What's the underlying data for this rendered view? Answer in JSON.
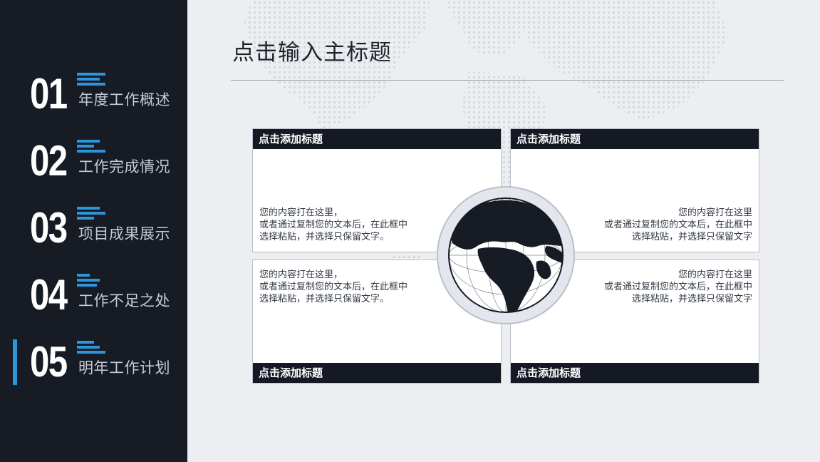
{
  "sidebar": {
    "items": [
      {
        "number": "01",
        "label": "年度工作概述"
      },
      {
        "number": "02",
        "label": "工作完成情况"
      },
      {
        "number": "03",
        "label": "项目成果展示"
      },
      {
        "number": "04",
        "label": "工作不足之处"
      },
      {
        "number": "05",
        "label": "明年工作计划"
      }
    ],
    "active_index": 4
  },
  "main": {
    "title": "点击输入主标题",
    "panels": [
      {
        "heading": "点击添加标题",
        "lines": [
          "您的内容打在这里，",
          "或者通过复制您的文本后，在此框中",
          "选择粘贴，并选择只保留文字。"
        ]
      },
      {
        "heading": "点击添加标题",
        "lines": [
          "您的内容打在这里",
          "或者通过复制您的文本后，在此框中",
          "选择粘贴，并选择只保留文字"
        ]
      },
      {
        "heading": "点击添加标题",
        "lines": [
          "您的内容打在这里，",
          "或者通过复制您的文本后，在此框中",
          "选择粘贴，并选择只保留文字。"
        ]
      },
      {
        "heading": "点击添加标题",
        "lines": [
          "您的内容打在这里",
          "或者通过复制您的文本后，在此框中",
          "选择粘贴，并选择只保留文字"
        ]
      }
    ]
  },
  "colors": {
    "sidebar_bg": "#161b24",
    "accent": "#2c95dc",
    "panel_header": "#141923",
    "page_bg": "#eceef1"
  },
  "icons": {
    "globe": "globe-icon",
    "world_map": "world-map-background"
  }
}
